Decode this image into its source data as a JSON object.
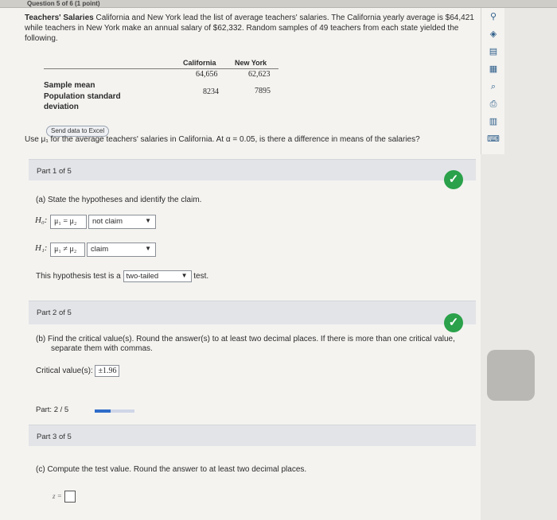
{
  "header": {
    "question_label": "Question 5 of 6 (1 point)"
  },
  "problem": {
    "title": "Teachers' Salaries",
    "text": "California and New York lead the list of average teachers' salaries. The California yearly average is $64,421 while teachers in New York make an annual salary of $62,332. Random samples of 49 teachers from each state yielded the following.",
    "table": {
      "col1": "California",
      "col2": "New York",
      "row1_label": "Sample mean",
      "row1_cal": "64,656",
      "row1_ny": "62,623",
      "row2_label": "Population standard deviation",
      "row2_cal": "8234",
      "row2_ny": "7895"
    },
    "excel_button": "Send data to Excel",
    "question": "Use μ₁ for the average teachers' salaries in California. At α = 0.05, is there a difference in means of the salaries?"
  },
  "part1": {
    "header": "Part 1 of 5",
    "prompt": "(a) State the hypotheses and identify the claim.",
    "h0_var": "H₀:",
    "h0_expr": "μ₁ = μ₂",
    "h0_claim": "not claim",
    "h1_var": "H₁:",
    "h1_expr": "μ₁ ≠ μ₂",
    "h1_claim": "claim",
    "test_prefix": "This hypothesis test is a",
    "test_value": "two-tailed",
    "test_suffix": "test."
  },
  "part2": {
    "header": "Part 2 of 5",
    "prompt": "(b) Find the critical value(s). Round the answer(s) to at least two decimal places. If there is more than one critical value, separate them with commas.",
    "critical_label": "Critical value(s):",
    "critical_value": "±1.96"
  },
  "progress": {
    "label": "Part: 2 / 5",
    "fraction": 0.4
  },
  "part3": {
    "header": "Part 3 of 5",
    "prompt": "(c) Compute the test value. Round the answer to at least two decimal places.",
    "z_label": "z ="
  },
  "icons": {
    "checkmark": "✓",
    "caret": "▼",
    "tools": [
      "pin-icon",
      "check-shield-icon",
      "notes-icon",
      "calculator-icon",
      "search-icon",
      "print-icon",
      "bar-chart-icon",
      "keyboard-icon"
    ]
  },
  "colors": {
    "accent": "#2e6cc9",
    "success": "#2aa14a"
  }
}
